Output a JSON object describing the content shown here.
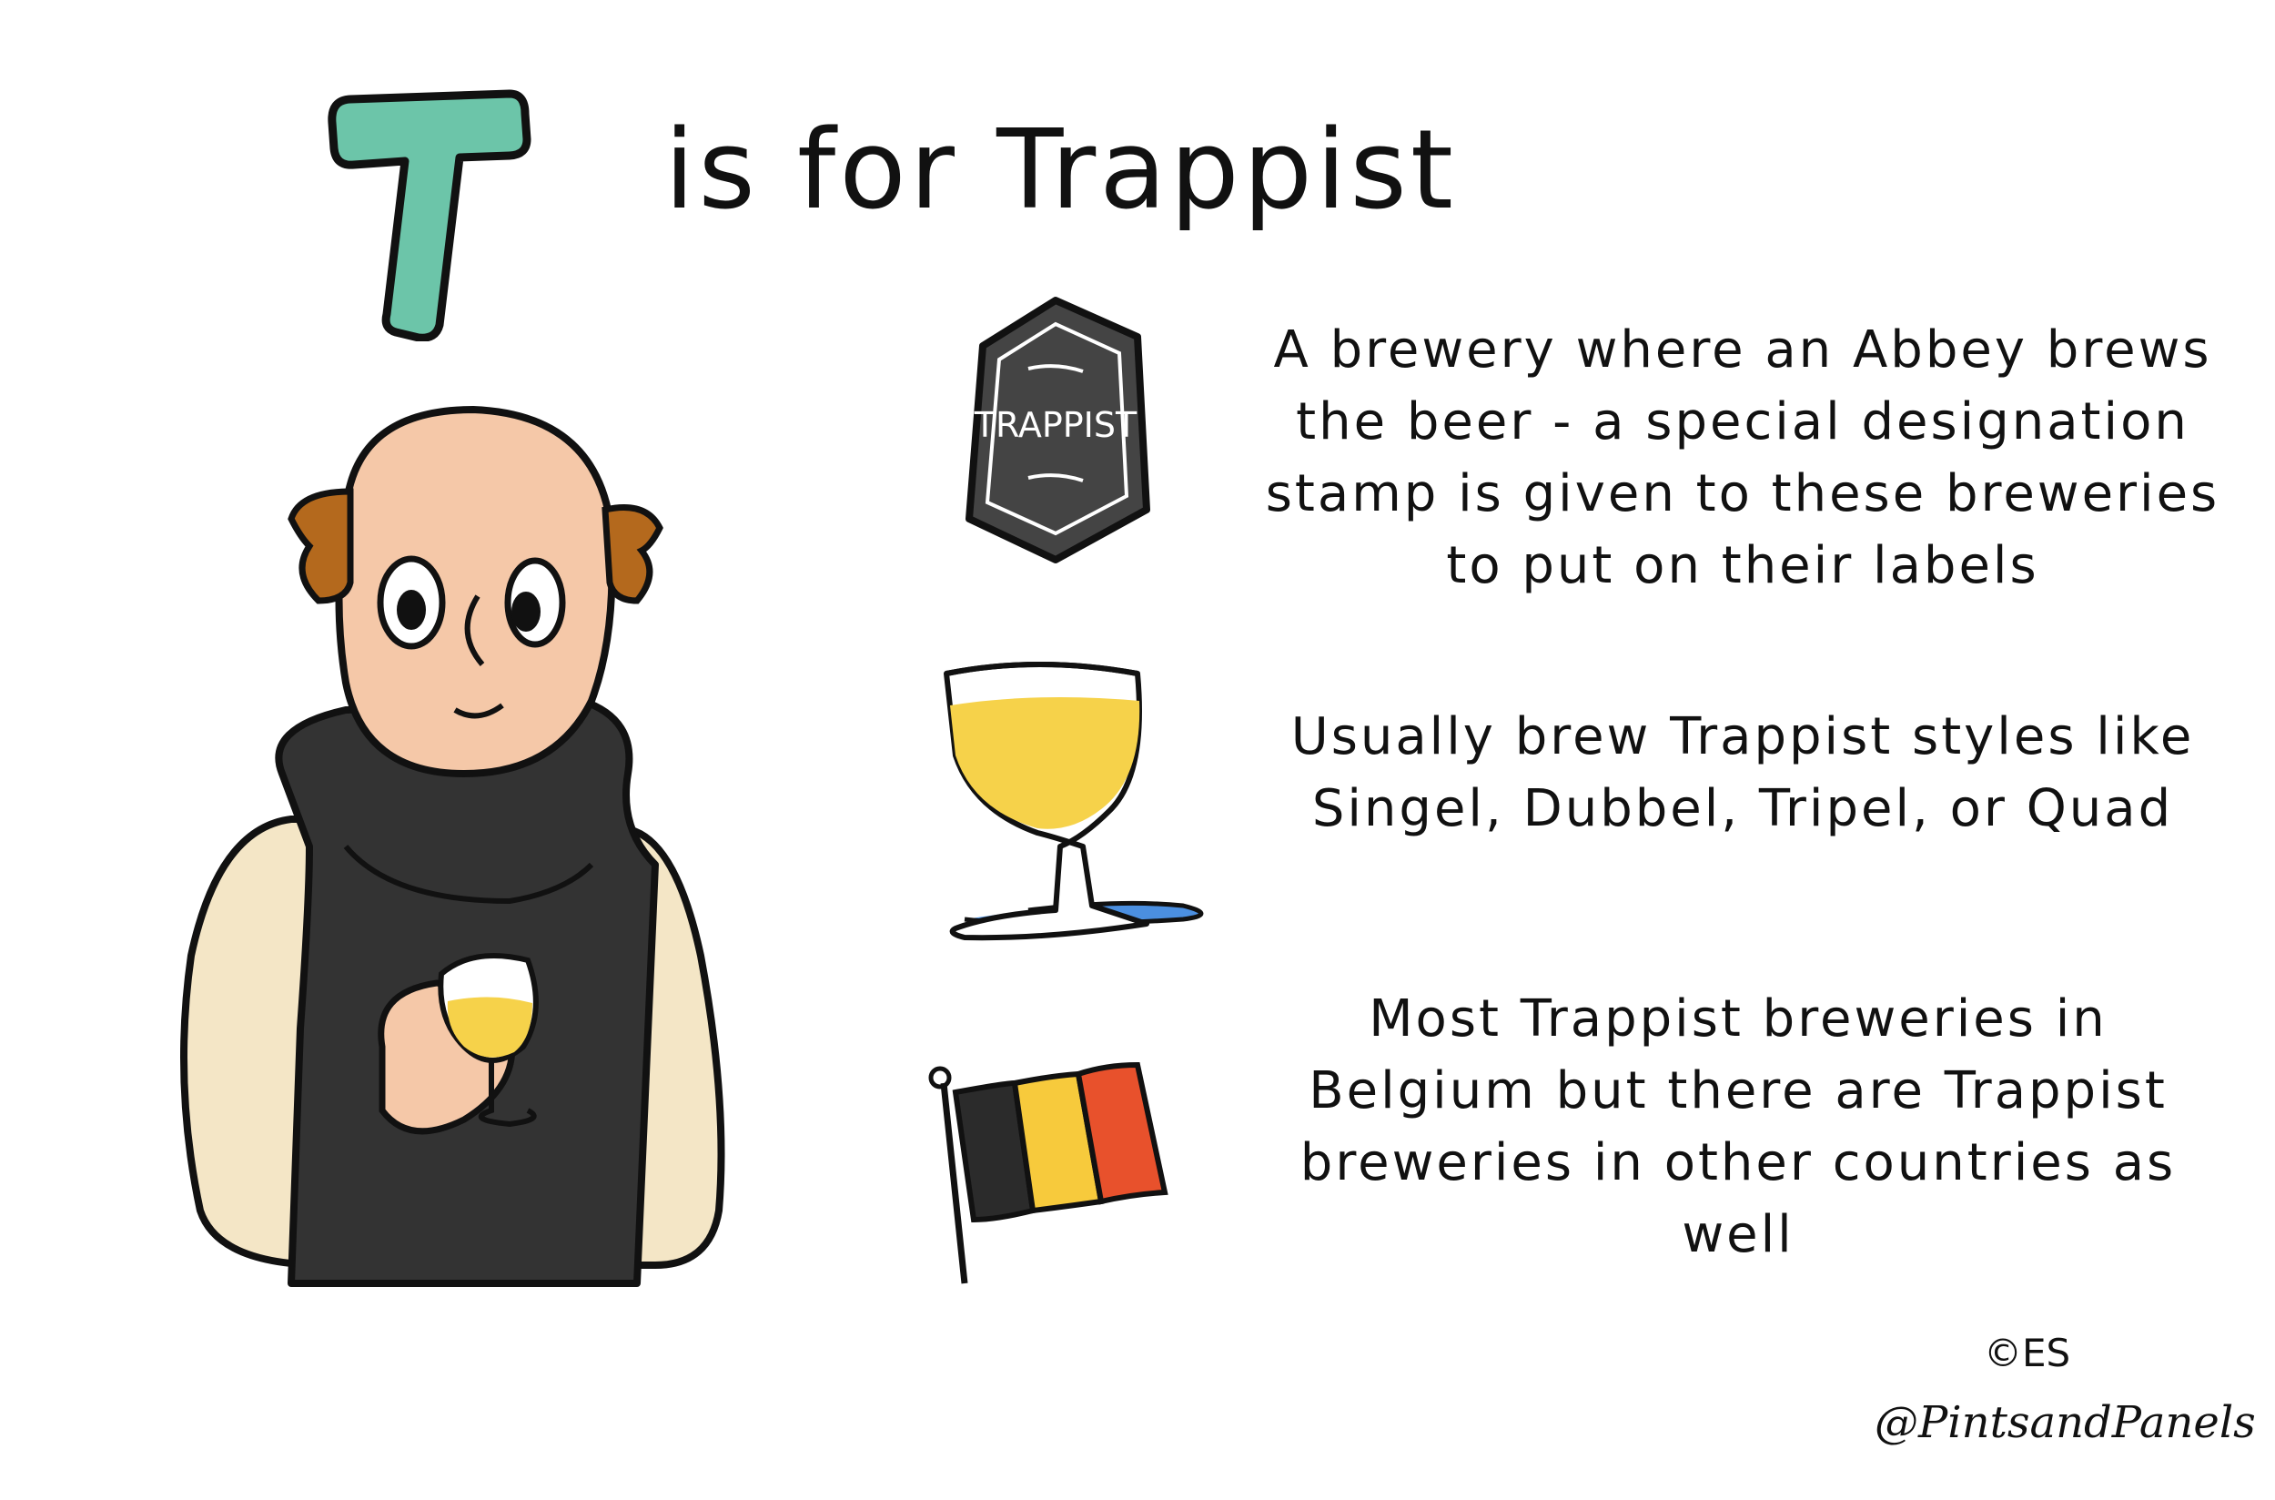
{
  "title": {
    "letter": "T",
    "text": "is for Trappist"
  },
  "badge": {
    "label": "TRAPPIST"
  },
  "facts": [
    {
      "text": "A brewery where an Abbey brews the beer - a special designation stamp is given to these breweries to put on their labels"
    },
    {
      "text": "Usually brew Trappist styles like Singel, Dubbel, Tripel, or Quad"
    },
    {
      "text": "Most Trappist breweries in Belgium but there are Trappist breweries in other countries as well"
    }
  ],
  "credit": {
    "copyright": "©ES",
    "handle": "@PintsandPanels"
  },
  "colors": {
    "letter_fill": "#6cc5a9",
    "skin": "#f5c8a8",
    "hair": "#b4691d",
    "robe": "#333333",
    "sleeve": "#f4e6c6",
    "beer": "#f6d24a",
    "puddle": "#4b8fe0",
    "flag_black": "#2b2b2b",
    "flag_yellow": "#f7ca3c",
    "flag_red": "#e8512c"
  },
  "icons": [
    "trappist-badge-icon",
    "chalice-glass-icon",
    "belgian-flag-icon"
  ]
}
